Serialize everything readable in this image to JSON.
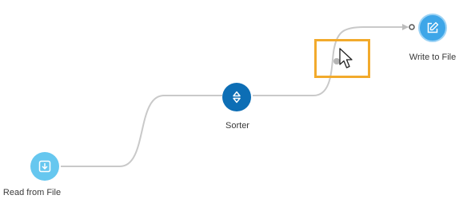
{
  "canvas": {
    "background": "#ffffff",
    "wire_color": "#c9c9c9",
    "selection_color": "#f2aa2c"
  },
  "nodes": {
    "read_from_file": {
      "label": "Read from File",
      "icon": "download-icon",
      "color": "#66c7ef"
    },
    "sorter": {
      "label": "Sorter",
      "icon": "sort-icon",
      "color": "#0d6eb5"
    },
    "write_to_file": {
      "label": "Write to File",
      "icon": "edit-icon",
      "color": "#3ea6e8"
    }
  }
}
